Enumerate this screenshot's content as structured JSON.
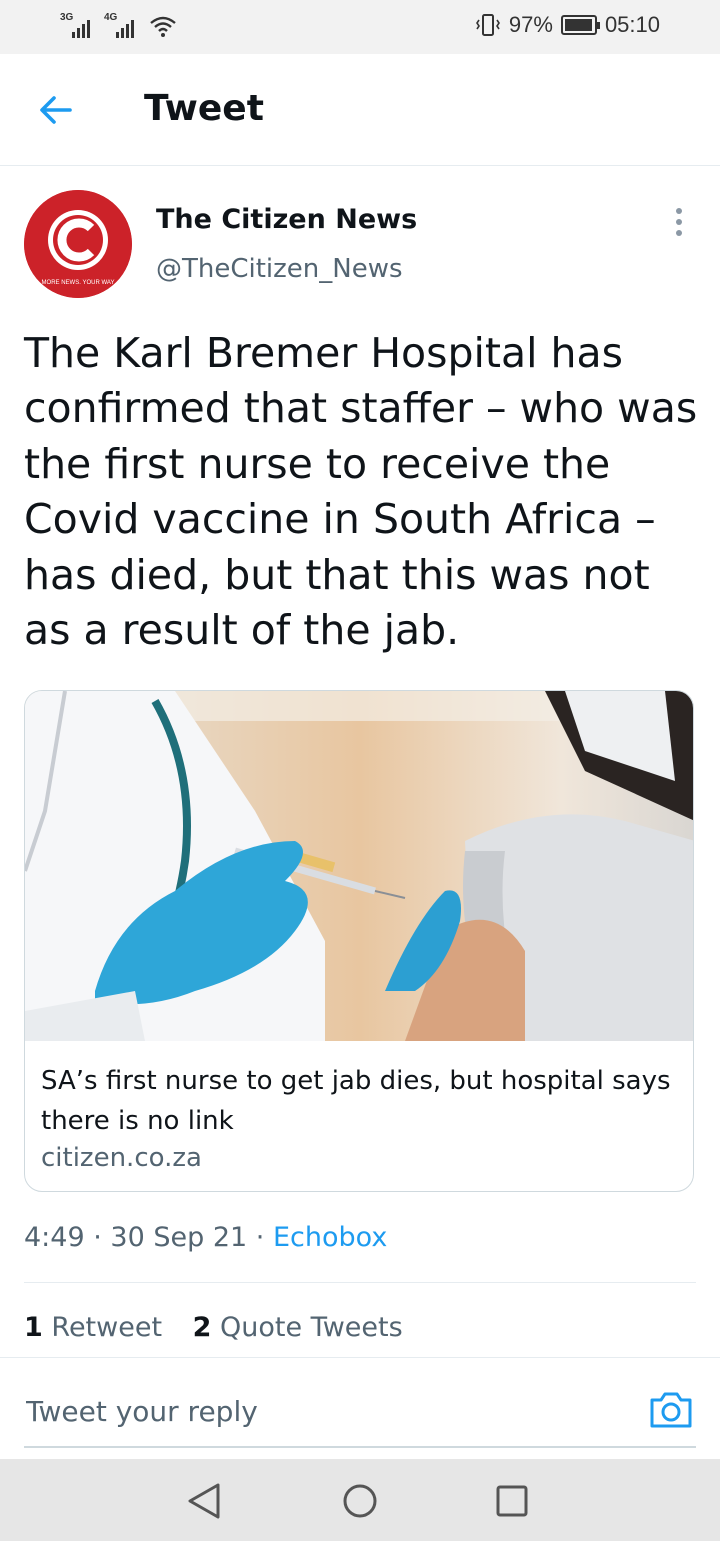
{
  "status_bar": {
    "sim1_tag": "3G",
    "sim2_tag": "4G",
    "battery_percent": "97%",
    "battery_level": 0.97,
    "time": "05:10"
  },
  "header": {
    "title": "Tweet",
    "back_icon": "arrow-left-icon"
  },
  "tweet": {
    "author_name": "The Citizen News",
    "author_handle": "@TheCitizen_News",
    "avatar_logo_text": "MORE NEWS. YOUR WAY",
    "text": "The Karl Bremer Hospital has confirmed that staffer – who was the first nurse to receive the Covid vaccine in South Africa – has died, but that this was not as a result of the jab.",
    "card": {
      "title": "SA’s first nurse to get jab dies, but hospital says there is no link",
      "domain": "citizen.co.za"
    },
    "time": "4:49",
    "date": "30 Sep 21",
    "source": "Echobox",
    "retweets_count": "1",
    "retweets_label": "Retweet",
    "quotes_count": "2",
    "quotes_label": "Quote Tweets"
  },
  "reply": {
    "placeholder": "Tweet your reply",
    "camera_icon": "camera-icon"
  },
  "nav": {
    "back_icon": "triangle-back-icon",
    "home_icon": "circle-home-icon",
    "recents_icon": "square-recents-icon"
  },
  "colors": {
    "accent": "#1d9bf0",
    "brand_red": "#cc2229",
    "muted": "#536471"
  }
}
